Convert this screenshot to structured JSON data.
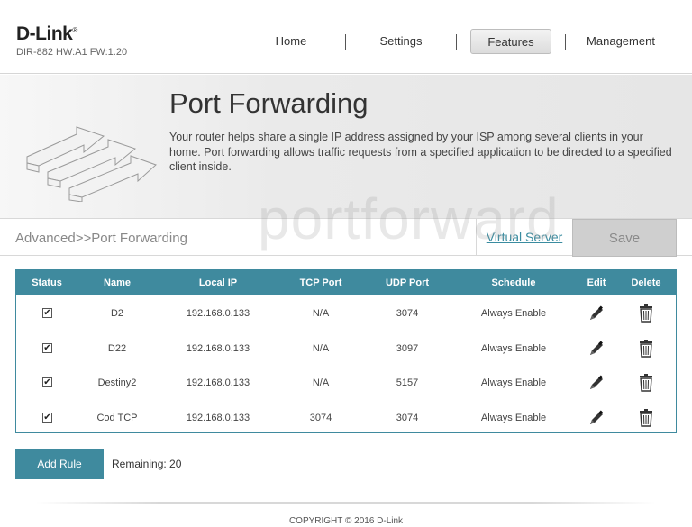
{
  "brand": {
    "logo": "D-Link",
    "model": "DIR-882 HW:A1 FW:1.20"
  },
  "nav": [
    {
      "label": "Home"
    },
    {
      "label": "Settings"
    },
    {
      "label": "Features",
      "active": true
    },
    {
      "label": "Management"
    }
  ],
  "banner": {
    "title": "Port Forwarding",
    "description": "Your router helps share a single IP address assigned by your ISP among several clients in your home. Port forwarding allows traffic requests from a specified application to be directed to a specified client inside."
  },
  "breadcrumb": "Advanced>>Port Forwarding",
  "virtual_server_link": "Virtual Server",
  "save_label": "Save",
  "watermark": "portforward",
  "table": {
    "headers": [
      "Status",
      "Name",
      "Local IP",
      "TCP Port",
      "UDP Port",
      "Schedule",
      "Edit",
      "Delete"
    ],
    "rows": [
      {
        "status": true,
        "name": "D2",
        "local_ip": "192.168.0.133",
        "tcp": "N/A",
        "udp": "3074",
        "schedule": "Always Enable"
      },
      {
        "status": true,
        "name": "D22",
        "local_ip": "192.168.0.133",
        "tcp": "N/A",
        "udp": "3097",
        "schedule": "Always Enable"
      },
      {
        "status": true,
        "name": "Destiny2",
        "local_ip": "192.168.0.133",
        "tcp": "N/A",
        "udp": "5157",
        "schedule": "Always Enable"
      },
      {
        "status": true,
        "name": "Cod TCP",
        "local_ip": "192.168.0.133",
        "tcp": "3074",
        "udp": "3074",
        "schedule": "Always Enable"
      }
    ]
  },
  "add_rule_label": "Add Rule",
  "remaining_text": "Remaining: 20",
  "copyright": "COPYRIGHT © 2016 D-Link",
  "colors": {
    "accent": "#3f8a9e",
    "link": "#3a8ca0",
    "save_bg": "#cfcfcf"
  },
  "icons": {
    "edit": "pencil-icon",
    "delete": "trash-icon",
    "banner": "port-arrows-icon"
  }
}
